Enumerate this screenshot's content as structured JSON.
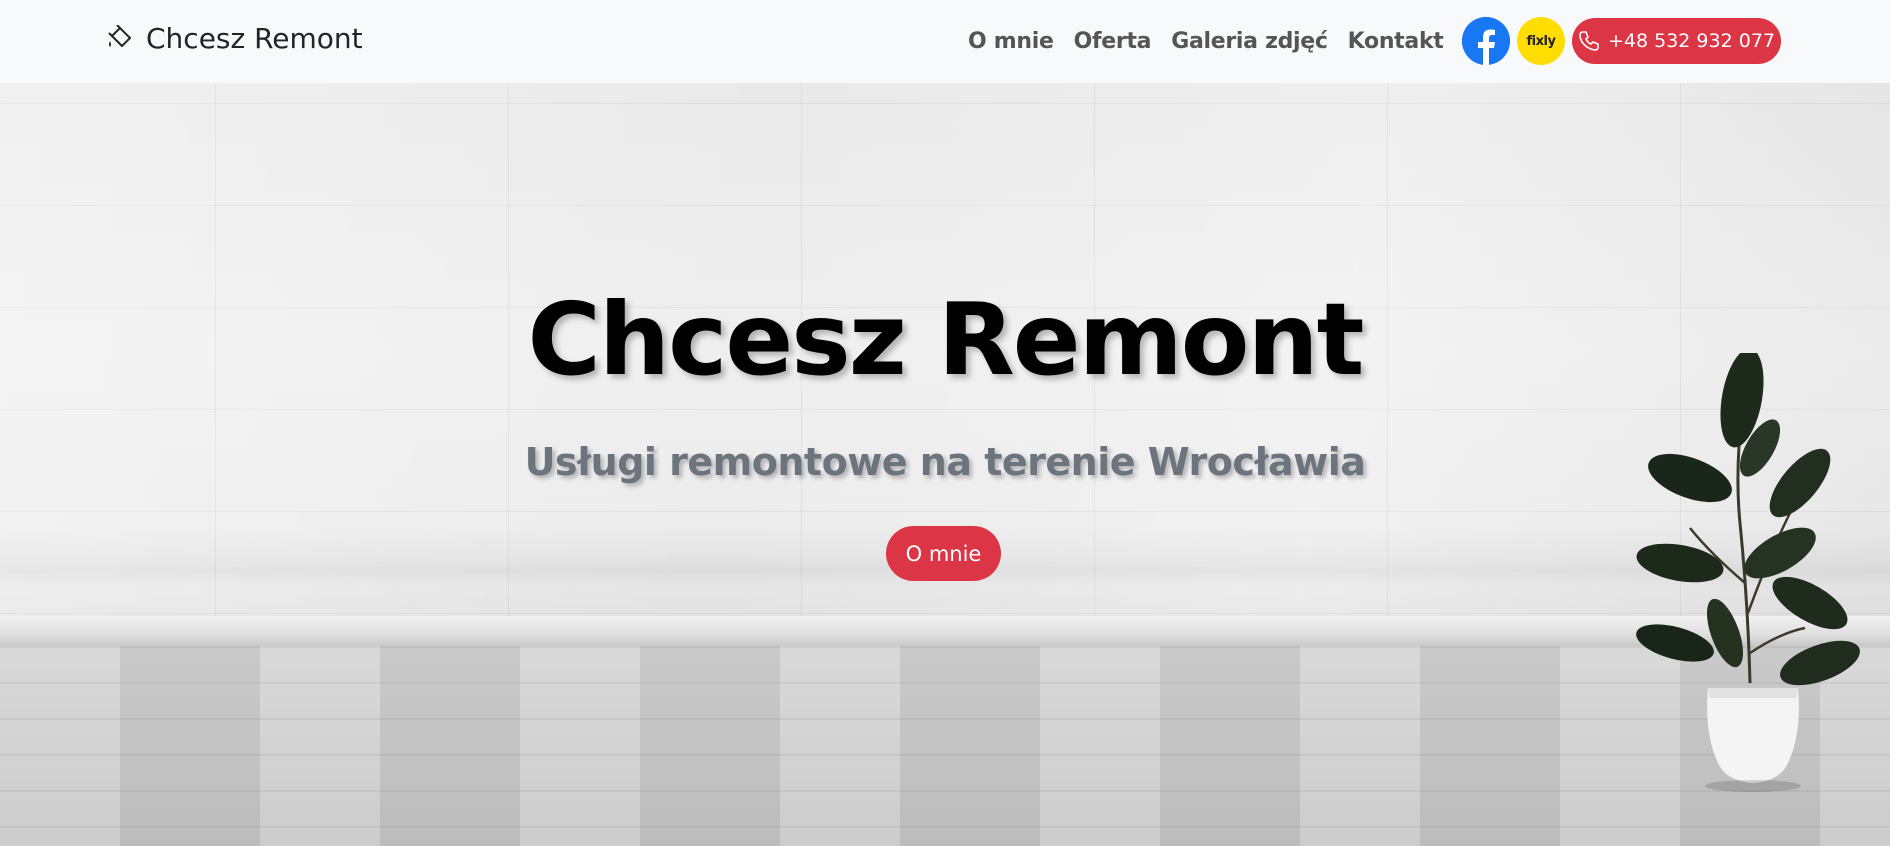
{
  "navbar": {
    "brand_icon": "paint-bucket-icon",
    "brand_text": "Chcesz Remont",
    "links": [
      "O mnie",
      "Oferta",
      "Galeria zdjęć",
      "Kontakt"
    ],
    "social": {
      "facebook_icon": "facebook-icon",
      "fixly_label": "fixly"
    },
    "phone_icon": "phone-icon",
    "phone": "+48 532 932 077"
  },
  "hero": {
    "title": "Chcesz Remont",
    "subtitle": "Usługi remontowe na terenie Wrocławia",
    "button": "O mnie"
  },
  "colors": {
    "accent": "#dc3545",
    "facebook": "#1877f2",
    "fixly": "#ffdd00",
    "navbar_bg": "#f8f9fa",
    "subtitle": "#6c757d"
  }
}
